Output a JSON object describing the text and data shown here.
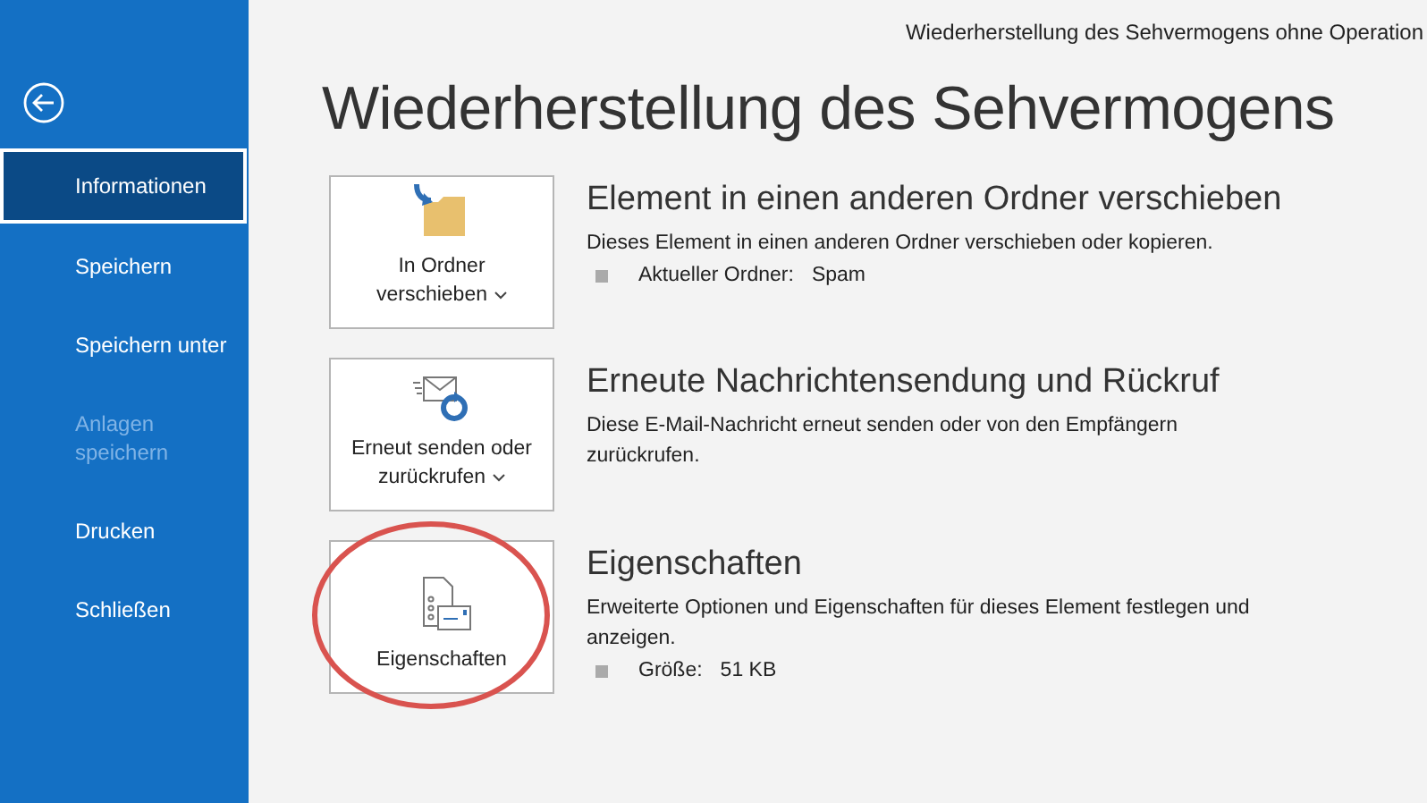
{
  "window": {
    "title": "Wiederherstellung des Sehvermogens ohne Operation"
  },
  "sidebar": {
    "items": [
      {
        "label": "Informationen",
        "selected": true,
        "disabled": false
      },
      {
        "label": "Speichern",
        "selected": false,
        "disabled": false
      },
      {
        "label": "Speichern unter",
        "selected": false,
        "disabled": false
      },
      {
        "label": "Anlagen speichern",
        "selected": false,
        "disabled": true
      },
      {
        "label": "Drucken",
        "selected": false,
        "disabled": false
      },
      {
        "label": "Schließen",
        "selected": false,
        "disabled": false
      }
    ]
  },
  "heading": "Wiederherstellung des Sehvermogens",
  "sections": [
    {
      "kind": "move",
      "button": {
        "label": "In Ordner verschieben",
        "dropdown": true
      },
      "title": "Element in einen anderen Ordner verschieben",
      "description": "Dieses Element in einen anderen Ordner verschieben oder kopieren.",
      "property": {
        "label": "Aktueller Ordner:",
        "value": "Spam"
      },
      "highlighted": false
    },
    {
      "kind": "resend",
      "button": {
        "label": "Erneut senden oder zurückrufen",
        "dropdown": true
      },
      "title": "Erneute Nachrichtensendung und Rückruf",
      "description": "Diese E-Mail-Nachricht erneut senden oder von den Empfängern zurückrufen.",
      "highlighted": false
    },
    {
      "kind": "properties",
      "button": {
        "label": "Eigenschaften",
        "dropdown": false
      },
      "title": "Eigenschaften",
      "description": "Erweiterte Optionen und Eigenschaften für dieses Element festlegen und anzeigen.",
      "property": {
        "label": "Größe:",
        "value": "51 KB"
      },
      "highlighted": true
    }
  ]
}
